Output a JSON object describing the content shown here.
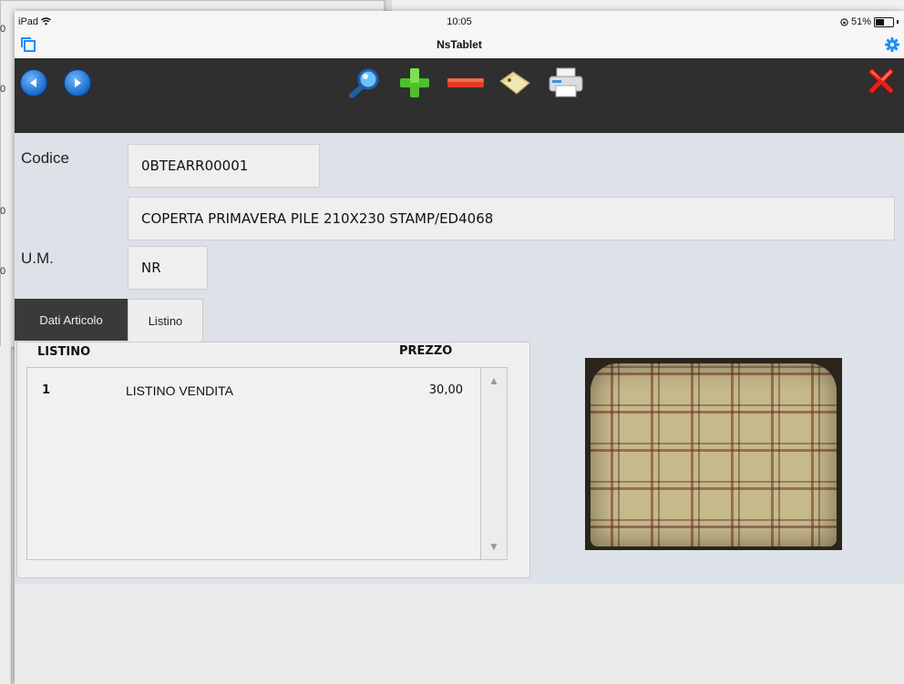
{
  "background": {
    "edge_numbers": [
      "0",
      "0",
      "0",
      "0"
    ]
  },
  "status_bar": {
    "device": "iPad",
    "time": "10:05",
    "battery": "51%",
    "battery_level": 0.51
  },
  "title_bar": {
    "title": "NsTablet",
    "left_icon": "windows-icon",
    "right_icon": "gear-icon"
  },
  "toolbar": {
    "buttons": [
      "back-icon",
      "forward-icon",
      "search-icon",
      "add-icon",
      "remove-icon",
      "label-icon",
      "print-icon",
      "close-icon"
    ]
  },
  "form": {
    "codice_label": "Codice",
    "codice_value": "0BTEARR00001",
    "descrizione_value": "COPERTA PRIMAVERA PILE 210X230 STAMP/ED4068",
    "um_label": "U.M.",
    "um_value": "NR"
  },
  "tabs": [
    {
      "label": "Dati Articolo",
      "active": false
    },
    {
      "label": "Listino",
      "active": true
    }
  ],
  "listino": {
    "headers": {
      "listino": "LISTINO",
      "prezzo": "PREZZO"
    },
    "rows": [
      {
        "num": "1",
        "name": "LISTINO VENDITA",
        "price": "30,00"
      }
    ]
  },
  "colors": {
    "toolbar": "#2f2f2f",
    "content_bg": "#dde1e8",
    "accent": "#1a8cff"
  }
}
